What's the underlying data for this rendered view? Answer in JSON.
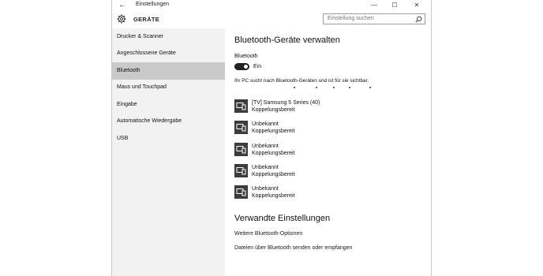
{
  "window": {
    "title": "Einstellungen",
    "controls": {
      "minimize": "—",
      "maximize": "☐",
      "close": "✕"
    },
    "back_icon": "arrow-left-icon"
  },
  "header": {
    "title": "GERÄTE",
    "icon": "gear-icon",
    "search_placeholder": "Einstellung suchen"
  },
  "sidebar": {
    "items": [
      {
        "label": "Drucker & Scanner",
        "active": false
      },
      {
        "label": "Angeschlossene Geräte",
        "active": false
      },
      {
        "label": "Bluetooth",
        "active": true
      },
      {
        "label": "Maus und Touchpad",
        "active": false
      },
      {
        "label": "Eingabe",
        "active": false
      },
      {
        "label": "Automatische Wiedergabe",
        "active": false
      },
      {
        "label": "USB",
        "active": false
      }
    ]
  },
  "main": {
    "title": "Bluetooth-Geräte verwalten",
    "bluetooth_label": "Bluetooth",
    "toggle_state": "Ein",
    "toggle_on": true,
    "status_text": "Ihr PC sucht nach Bluetooth-Geräten und ist für sie sichtbar.",
    "devices": [
      {
        "name": "[TV] Samsung 5 Series (40)",
        "status": "Koppelungsbereit"
      },
      {
        "name": "Unbekannt",
        "status": "Koppelungsbereit"
      },
      {
        "name": "Unbekannt",
        "status": "Koppelungsbereit"
      },
      {
        "name": "Unbekannt",
        "status": "Koppelungsbereit"
      },
      {
        "name": "Unbekannt",
        "status": "Koppelungsbereit"
      }
    ],
    "related_title": "Verwandte Einstellungen",
    "related_links": [
      "Weitere Bluetooth-Optionen",
      "Dateien über Bluetooth senden oder empfangen"
    ]
  },
  "colors": {
    "sidebar_bg": "#f2f2f2",
    "sidebar_active": "#c9c9c9",
    "toggle_on": "#222222",
    "device_icon_bg": "#3c3c3c"
  }
}
